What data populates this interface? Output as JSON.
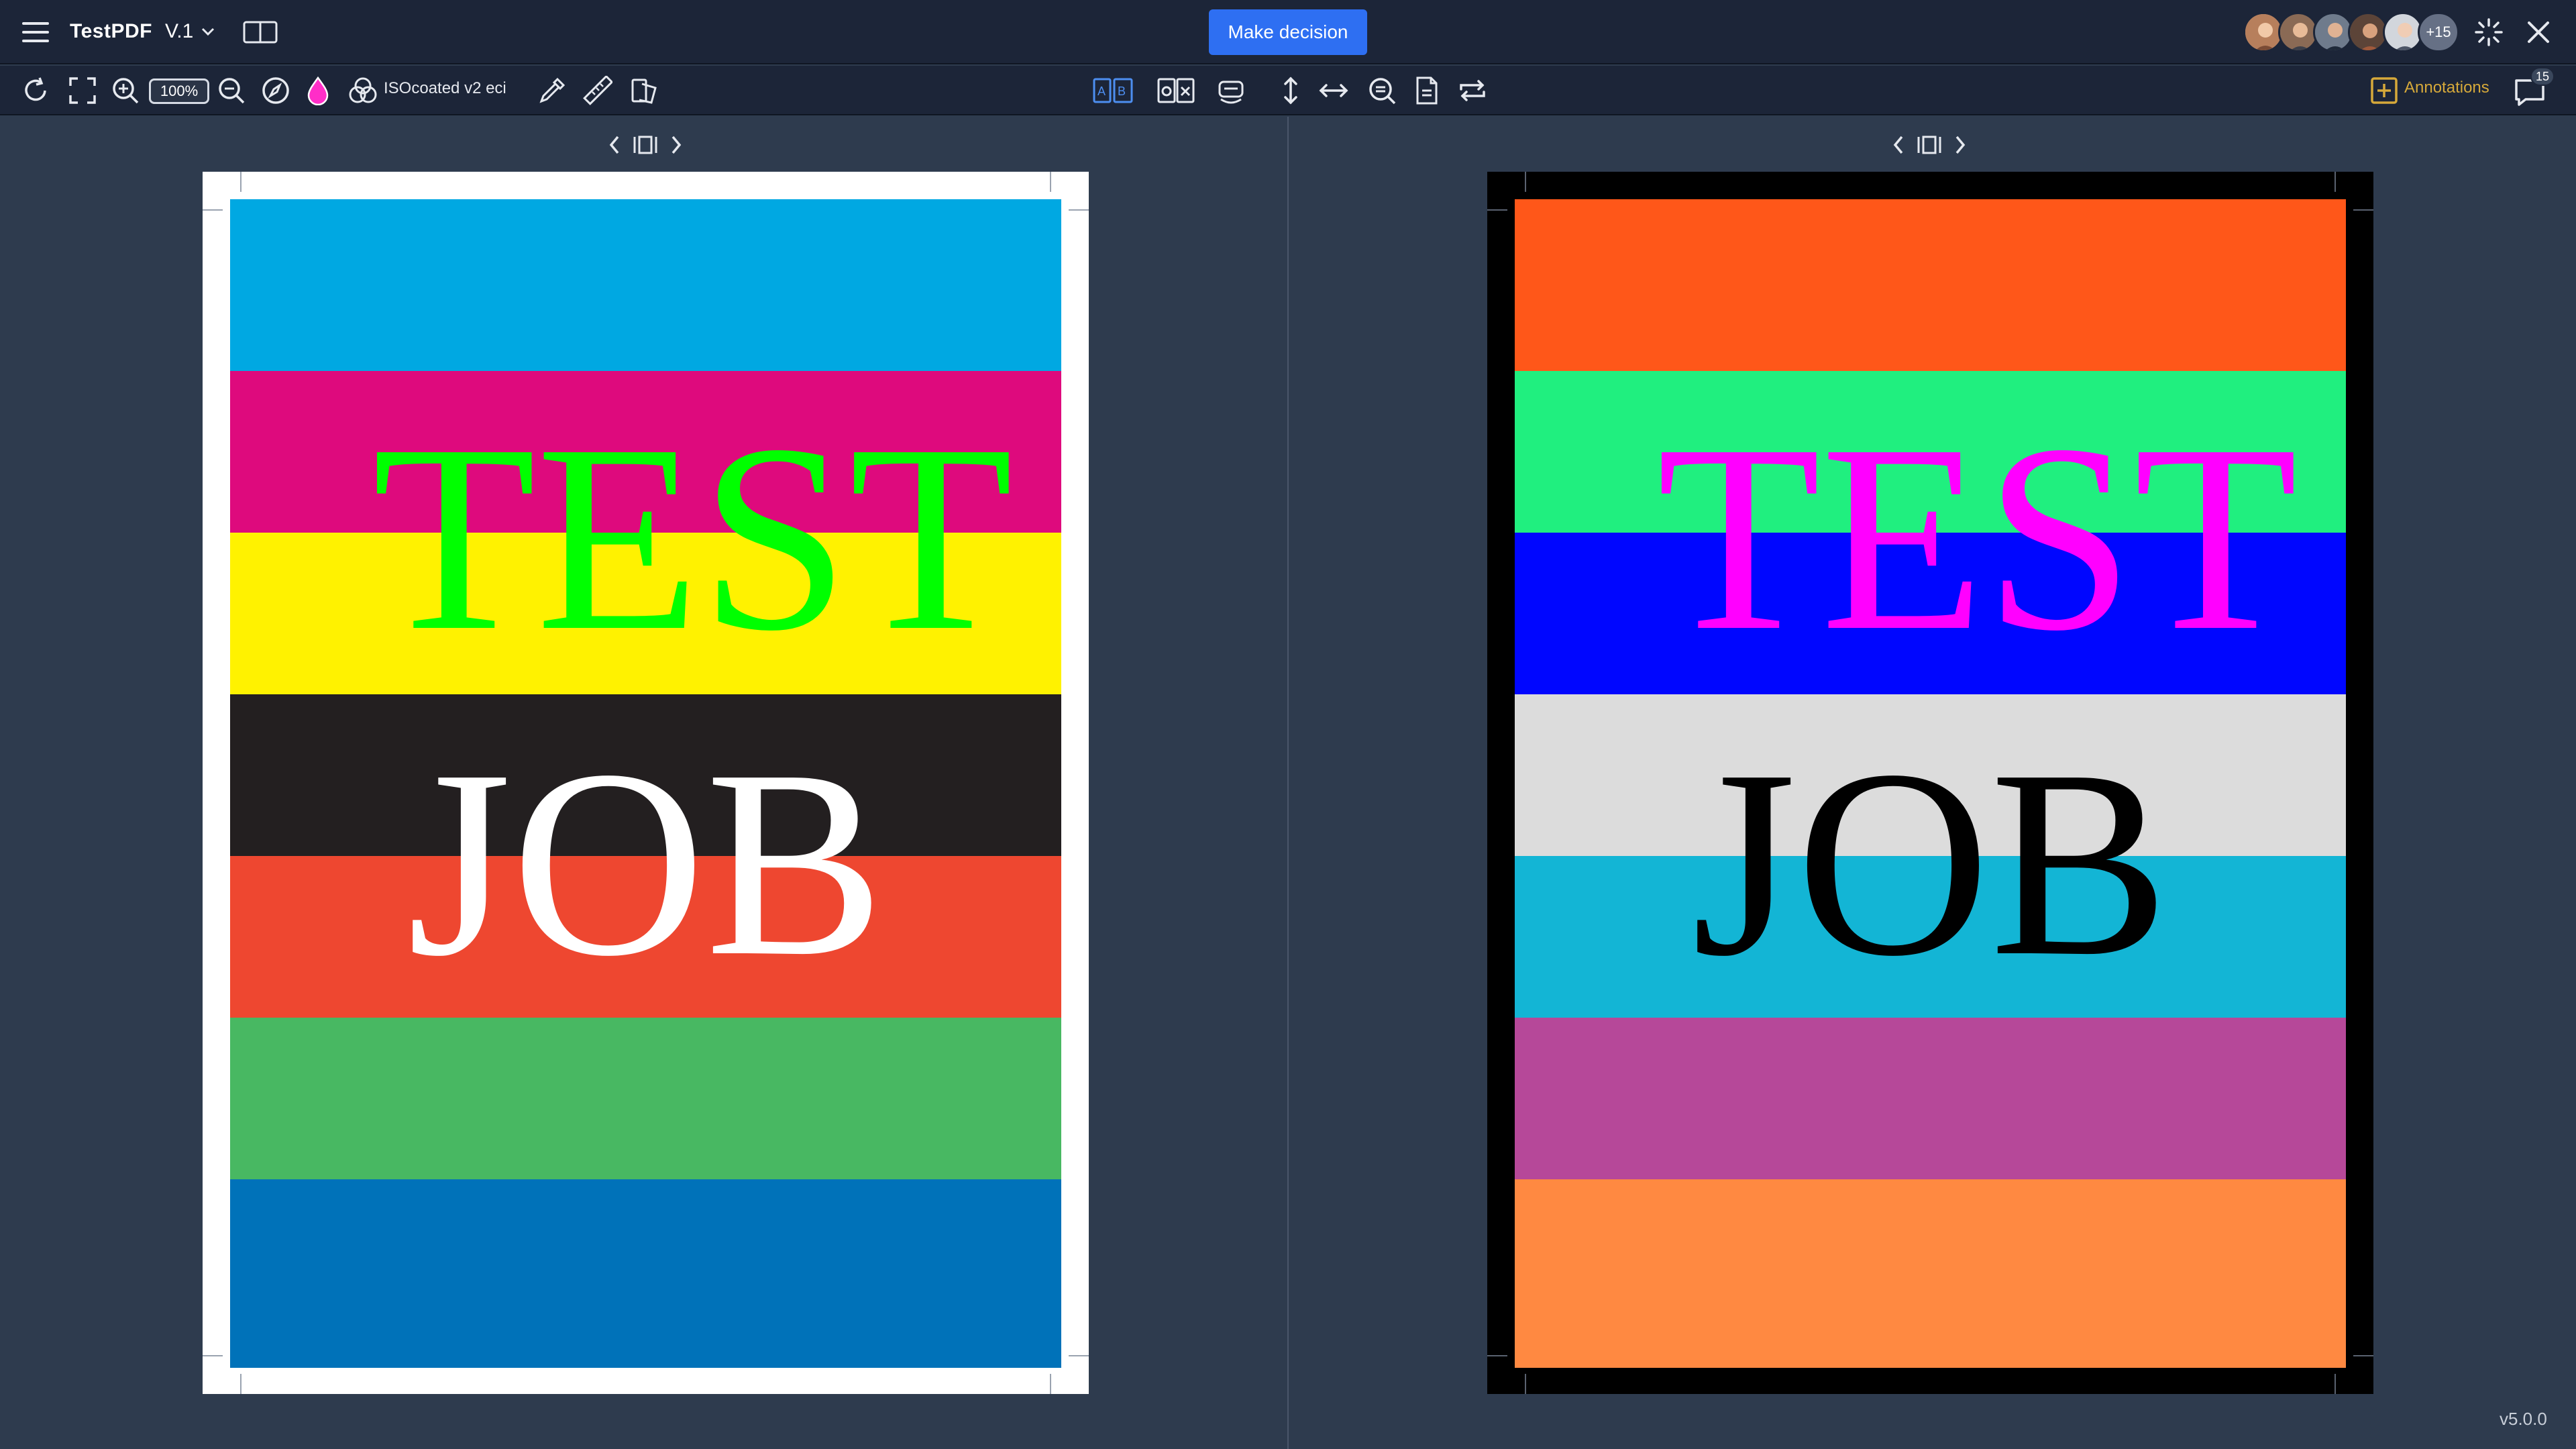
{
  "header": {
    "app_title": "TestPDF",
    "version": "V.1",
    "decision_button": "Make decision",
    "collaborators_more": "+15"
  },
  "toolbar": {
    "zoom": "100%",
    "color_profile": "ISOcoated v2 eci",
    "annotations_label": "Annotations",
    "comments_count": "15",
    "accent_color": "#d6a93a",
    "active_icon_color": "#4d8ef0"
  },
  "viewer": {
    "left_page": {
      "background": "#ffffff",
      "bands": [
        "#00a8e2",
        "#de0a7d",
        "#fff200",
        "#231f20",
        "#ee4730",
        "#48b862",
        "#0072b9"
      ],
      "word_top": "TEST",
      "word_top_color": "#00ff00",
      "word_bottom": "JOB",
      "word_bottom_color": "#ffffff"
    },
    "right_page": {
      "background": "#000000",
      "bands": [
        "#ff5719",
        "#20ef7f",
        "#0006ff",
        "#dcdcdc",
        "#13b5d5",
        "#b64899",
        "#ff8941"
      ],
      "word_top": "TEST",
      "word_top_color": "#ff00ff",
      "word_bottom": "JOB",
      "word_bottom_color": "#000000"
    }
  },
  "footer": {
    "app_version": "v5.0.0"
  }
}
